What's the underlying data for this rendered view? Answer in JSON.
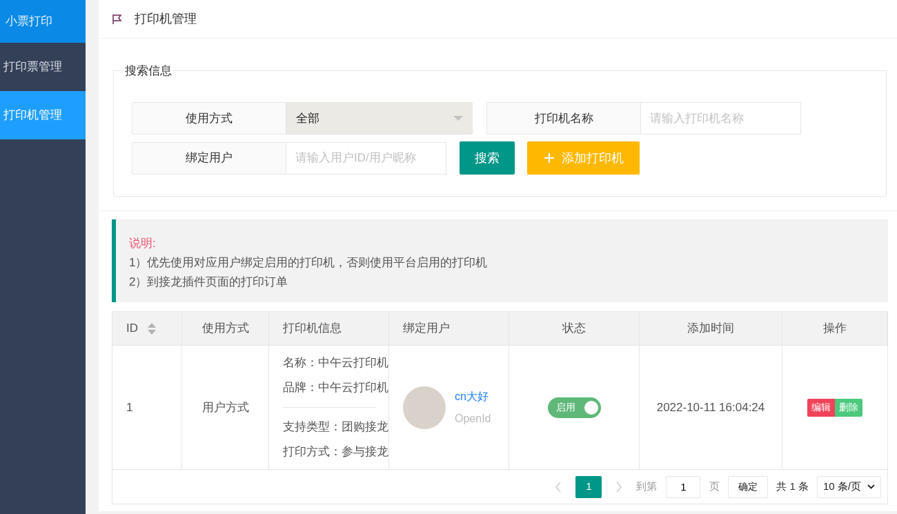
{
  "sidebar": {
    "title": "小票打印",
    "items": [
      {
        "label": "打印票管理",
        "selected": false
      },
      {
        "label": "打印机管理",
        "selected": true
      }
    ]
  },
  "header": {
    "title": "打印机管理"
  },
  "search": {
    "legend": "搜索信息",
    "usage": {
      "label": "使用方式",
      "value": "全部"
    },
    "printer_name": {
      "label": "打印机名称",
      "placeholder": "请输入打印机名称"
    },
    "bound_user": {
      "label": "绑定用户",
      "placeholder": "请输入用户ID/用户昵称"
    },
    "search_button": "搜索",
    "add_button": "添加打印机"
  },
  "note": {
    "title": "说明:",
    "lines": [
      "1）优先使用对应用户绑定启用的打印机，否则使用平台启用的打印机",
      "2）到接龙插件页面的打印订单"
    ]
  },
  "table": {
    "columns": [
      "ID",
      "使用方式",
      "打印机信息",
      "绑定用户",
      "状态",
      "添加时间",
      "操作"
    ],
    "rows": [
      {
        "id": "1",
        "usage": "用户方式",
        "info_top": [
          "名称：中午云打印机",
          "品牌：中午云打印机"
        ],
        "info_bottom": [
          "支持类型：团购接龙",
          "打印方式：参与接龙"
        ],
        "user_name": "cn大好",
        "user_sub": "OpenId",
        "status": {
          "label": "启用",
          "on": true
        },
        "added": "2022-10-11 16:04:24",
        "actions": [
          "编辑",
          "删除"
        ]
      }
    ]
  },
  "pager": {
    "current": "1",
    "goto_label": "到第",
    "goto_value": "1",
    "page_unit": "页",
    "confirm": "确定",
    "total": "共 1 条",
    "page_size": "10 条/页"
  }
}
